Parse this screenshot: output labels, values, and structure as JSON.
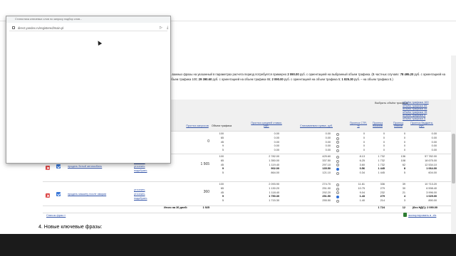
{
  "browser_popup": {
    "title": "Статистика ключевых слов по запросу подбор слов...",
    "address": "direct.yandex.ru/registered/main.pl"
  },
  "notice": {
    "part1": "...важных фразы на указанный в параметрах расчета период потребуется примерно ",
    "amount1": "2 090.00",
    "part2": " руб. с ориентацией на выбранный объем трафика. (В частных случаях: ",
    "amount2": "78 495.20",
    "part3": " руб. с ориентацией на объем трафика 100; ",
    "amount3": "29 390.60",
    "part4": " руб. с ориентацией на объем трафика 65; ",
    "amount4": "2 090.00",
    "part5": " руб. с ориентацией на объем трафика 5; ",
    "amount5": "1 825.30",
    "part6": " руб. – на объем трафика 5.)"
  },
  "traffic_selector": {
    "label": "Выбрать объём трафика:",
    "options": [
      "объём трафика 100",
      "объём трафика 65",
      "объём трафика 45",
      "объём трафика 15",
      "объём трафика 5",
      "объём трафика 5"
    ]
  },
  "columns": {
    "queries": "Прогноз запросов",
    "traffic": "Объем трафика",
    "avg_bid": "Прогноз средней ставки, руб.",
    "spend": "Списываемая сумма, руб.",
    "ctr": "Прогноз CTR, %",
    "shows": "Прогноз показов",
    "clicks": "Прогноз кликов",
    "budget": "Прогноз бюджета, руб."
  },
  "rows": [
    {
      "phrase": "",
      "actions": [],
      "queries": "0",
      "lines": [
        {
          "traffic": "100",
          "bid": "0.00",
          "spend": "0.00",
          "ctr": "0",
          "shows": "0",
          "clicks": "0",
          "budget": "0.00"
        },
        {
          "traffic": "65",
          "bid": "0.00",
          "spend": "0.00",
          "ctr": "0",
          "shows": "0",
          "clicks": "0",
          "budget": "0.00"
        },
        {
          "traffic": "45",
          "bid": "0.00",
          "spend": "0.00",
          "ctr": "0",
          "shows": "0",
          "clicks": "0",
          "budget": "0.00"
        },
        {
          "traffic": "9",
          "bid": "0.00",
          "spend": "0.00",
          "ctr": "0",
          "shows": "0",
          "clicks": "0",
          "budget": "0.00"
        },
        {
          "traffic": "5",
          "bid": "0.00",
          "spend": "0.00",
          "ctr": "0",
          "shows": "0",
          "clicks": "0",
          "budget": "0.00"
        }
      ]
    },
    {
      "phrase": "продать битый автомобиль",
      "actions": [
        "уточнить",
        "уточнить",
        "подобрать"
      ],
      "queries": "1 565",
      "lines": [
        {
          "traffic": "100",
          "bid": "2 782.00",
          "spend": "425.60",
          "ctr": "8.13",
          "shows": "1 732",
          "clicks": "136",
          "budget": "57 782.00"
        },
        {
          "traffic": "65",
          "bid": "1 350.00",
          "spend": "337.50",
          "ctr": "6.25",
          "shows": "1 732",
          "clicks": "108",
          "budget": "18 675.00"
        },
        {
          "traffic": "45",
          "bid": "1 119.40",
          "spend": "297.10",
          "ctr": "3.60",
          "shows": "1 732",
          "clicks": "62",
          "budget": "12 534.10"
        },
        {
          "traffic": "9",
          "bid": "902.00",
          "spend": "135.50",
          "ctr": "0.56",
          "shows": "1 445",
          "clicks": "8",
          "budget": "1 064.00"
        },
        {
          "traffic": "5",
          "bid": "864.00",
          "spend": "121.10",
          "ctr": "0.34",
          "shows": "1 445",
          "clicks": "5",
          "budget": "604.00"
        }
      ]
    },
    {
      "phrase": "продать машину после аварии",
      "actions": [
        "уточнить",
        "уточнить",
        "подобрать"
      ],
      "queries": "360",
      "lines": [
        {
          "traffic": "100",
          "bid": "2 093.90",
          "spend": "274.70",
          "ctr": "11.61",
          "shows": "336",
          "clicks": "39",
          "budget": "10 713.20"
        },
        {
          "traffic": "65",
          "bid": "1 130.20",
          "spend": "251.90",
          "ctr": "10.75",
          "shows": "279",
          "clicks": "30",
          "budget": "6 598.40"
        },
        {
          "traffic": "45",
          "bid": "1 118.40",
          "spend": "292.20",
          "ctr": "9.04",
          "shows": "232",
          "clicks": "21",
          "budget": "3 996.00"
        },
        {
          "traffic": "9",
          "bid": "1 750.30",
          "spend": "251.50",
          "ctr": "1.43",
          "shows": "279",
          "clicks": "4",
          "budget": "1 025.00"
        },
        {
          "traffic": "5",
          "bid": "1 715.30",
          "spend": "255.50",
          "ctr": "1.40",
          "shows": "214",
          "clicks": "3",
          "budget": "890.00"
        }
      ]
    }
  ],
  "totals": {
    "label": "Итого на 30 дней:",
    "queries": "1 925",
    "shows": "1 724",
    "clicks": "12",
    "budget": "(без НДС): 2 090.00"
  },
  "links": {
    "phrase_list": "Список фраз »",
    "export": "экспортировать в .xls"
  },
  "section_title": "4. Новые ключевые фразы:",
  "colors": {
    "link": "#2f51a6",
    "radio_selected": "#2f6fd6",
    "delete": "#d83434",
    "checkbox": "#3a78d8"
  }
}
